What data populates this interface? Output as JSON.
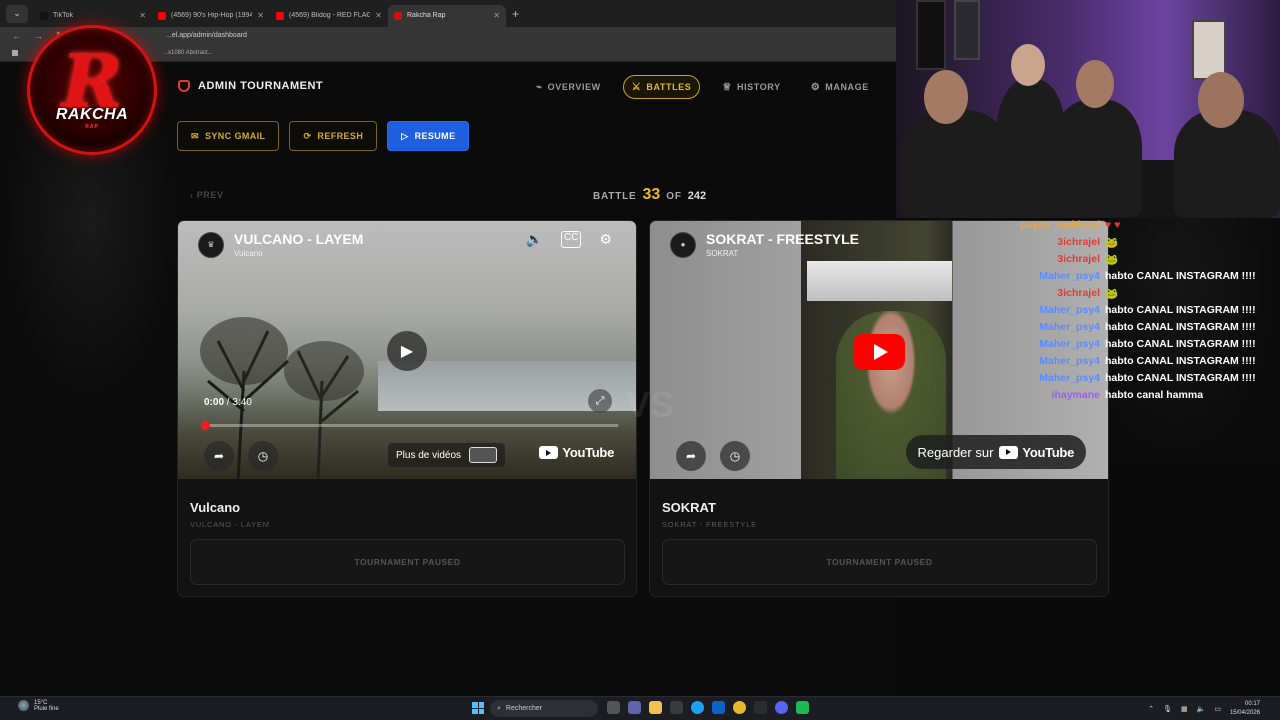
{
  "browser": {
    "tabs": [
      {
        "title": "TikTok",
        "fav_color": "#111111",
        "active": false
      },
      {
        "title": "(4569) 90's Hip-Hop (1994) [Lo...",
        "fav_color": "#ff0000",
        "active": false
      },
      {
        "title": "(4569) Blidog - RED FLAG (Offi...",
        "fav_color": "#ff0000",
        "active": false
      },
      {
        "title": "Rakcha Rap",
        "fav_color": "#cc1111",
        "active": true
      }
    ],
    "url": "...el.app/admin/dashboard",
    "bookmark": "...x1080 Abstract..."
  },
  "logo": {
    "letter": "R",
    "word": "RAKCHA",
    "sub": "RAP"
  },
  "app": {
    "title": "ADMIN TOURNAMENT",
    "nav": [
      {
        "label": "OVERVIEW",
        "icon": "pulse-icon",
        "glyph": "⌁",
        "active": false
      },
      {
        "label": "BATTLES",
        "icon": "swords-icon",
        "glyph": "⚔",
        "active": true
      },
      {
        "label": "HISTORY",
        "icon": "trophy-icon",
        "glyph": "♕",
        "active": false
      },
      {
        "label": "MANAGE",
        "icon": "gear-icon",
        "glyph": "⚙",
        "active": false
      }
    ],
    "actions": {
      "sync": "SYNC GMAIL",
      "refresh": "REFRESH",
      "resume": "RESUME"
    },
    "prev": "‹ PREV",
    "battle": {
      "label": "BATTLE",
      "current": "33",
      "of": "OF",
      "total": "242"
    },
    "vs": "VS",
    "cards": [
      {
        "video_title": "VULCANO - LAYEM",
        "channel": "Vulcano",
        "time_current": "0:00",
        "time_total": "3:40",
        "more_videos": "Plus de vidéos",
        "youtube": "YouTube",
        "name": "Vulcano",
        "sub": "VULCANO  -  LAYEM",
        "status": "TOURNAMENT PAUSED"
      },
      {
        "video_title": "SOKRAT - FREESTYLE",
        "channel": "SOKRAT",
        "watch_on": "Regarder sur",
        "youtube": "YouTube",
        "name": "SOKRAT",
        "sub": "SOKRAT  -  FREESTYLE",
        "status": "TOURNAMENT PAUSED"
      }
    ]
  },
  "chat": [
    {
      "user": "psyco_mahboul",
      "msg": "♥ ♥",
      "color": "#f5a623",
      "msg_color": "#e53935"
    },
    {
      "user": "3ichrajel",
      "msg": "🐸",
      "color": "#e53935",
      "msg_color": "#4caf50"
    },
    {
      "user": "3ichrajel",
      "msg": "🐸",
      "color": "#e53935",
      "msg_color": "#4caf50"
    },
    {
      "user": "Maher_psy4",
      "msg": "habto CANAL INSTAGRAM !!!!",
      "color": "#5b8cff",
      "msg_color": "#ffffff"
    },
    {
      "user": "3ichrajel",
      "msg": "🐸",
      "color": "#e53935",
      "msg_color": "#4caf50"
    },
    {
      "user": "Maher_psy4",
      "msg": "habto CANAL INSTAGRAM !!!!",
      "color": "#5b8cff",
      "msg_color": "#ffffff"
    },
    {
      "user": "Maher_psy4",
      "msg": "habto CANAL INSTAGRAM !!!!",
      "color": "#5b8cff",
      "msg_color": "#ffffff"
    },
    {
      "user": "Maher_psy4",
      "msg": "habto CANAL INSTAGRAM !!!!",
      "color": "#5b8cff",
      "msg_color": "#ffffff"
    },
    {
      "user": "Maher_psy4",
      "msg": "habto CANAL INSTAGRAM !!!!",
      "color": "#5b8cff",
      "msg_color": "#ffffff"
    },
    {
      "user": "Maher_psy4",
      "msg": "habto CANAL INSTAGRAM !!!!",
      "color": "#5b8cff",
      "msg_color": "#ffffff"
    },
    {
      "user": "ihaymane",
      "msg": "habto canal hamma",
      "color": "#a259ff",
      "msg_color": "#ffffff"
    }
  ],
  "taskbar": {
    "temp": "15°C",
    "weather": "Pluie fine",
    "search": "Rechercher",
    "time": "00:17",
    "date": "15/04/2026"
  },
  "colors": {
    "accent_gold": "#e0b838",
    "accent_blue": "#1d5fe0",
    "brand_red": "#e01414"
  }
}
